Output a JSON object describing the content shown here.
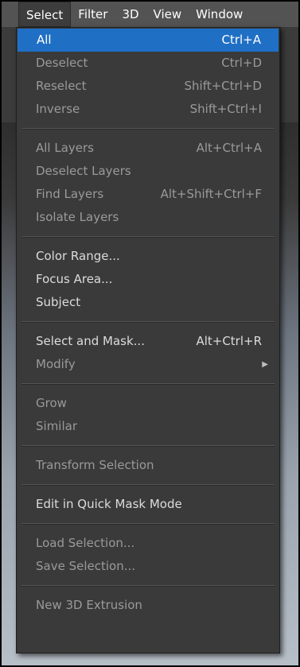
{
  "menubar": {
    "items": [
      "Select",
      "Filter",
      "3D",
      "View",
      "Window"
    ]
  },
  "menu": {
    "groups": [
      [
        {
          "label": "All",
          "shortcut": "Ctrl+A",
          "state": "highlight"
        },
        {
          "label": "Deselect",
          "shortcut": "Ctrl+D",
          "state": "disabled"
        },
        {
          "label": "Reselect",
          "shortcut": "Shift+Ctrl+D",
          "state": "disabled"
        },
        {
          "label": "Inverse",
          "shortcut": "Shift+Ctrl+I",
          "state": "disabled"
        }
      ],
      [
        {
          "label": "All Layers",
          "shortcut": "Alt+Ctrl+A",
          "state": "disabled"
        },
        {
          "label": "Deselect Layers",
          "shortcut": "",
          "state": "disabled"
        },
        {
          "label": "Find Layers",
          "shortcut": "Alt+Shift+Ctrl+F",
          "state": "disabled"
        },
        {
          "label": "Isolate Layers",
          "shortcut": "",
          "state": "disabled"
        }
      ],
      [
        {
          "label": "Color Range...",
          "shortcut": "",
          "state": "enabled"
        },
        {
          "label": "Focus Area...",
          "shortcut": "",
          "state": "enabled"
        },
        {
          "label": "Subject",
          "shortcut": "",
          "state": "enabled"
        }
      ],
      [
        {
          "label": "Select and Mask...",
          "shortcut": "Alt+Ctrl+R",
          "state": "enabled"
        },
        {
          "label": "Modify",
          "shortcut": "",
          "state": "disabled",
          "submenu": true
        }
      ],
      [
        {
          "label": "Grow",
          "shortcut": "",
          "state": "disabled"
        },
        {
          "label": "Similar",
          "shortcut": "",
          "state": "disabled"
        }
      ],
      [
        {
          "label": "Transform Selection",
          "shortcut": "",
          "state": "disabled"
        }
      ],
      [
        {
          "label": "Edit in Quick Mask Mode",
          "shortcut": "",
          "state": "enabled"
        }
      ],
      [
        {
          "label": "Load Selection...",
          "shortcut": "",
          "state": "disabled"
        },
        {
          "label": "Save Selection...",
          "shortcut": "",
          "state": "disabled"
        }
      ],
      [
        {
          "label": "New 3D Extrusion",
          "shortcut": "",
          "state": "disabled"
        }
      ]
    ]
  },
  "colors": {
    "highlight": "#1f6fc5",
    "menu_bg": "#3a3a3a",
    "menubar_bg": "#535353",
    "enabled_text": "#dcdcdc",
    "disabled_text": "#9a9a9a"
  }
}
